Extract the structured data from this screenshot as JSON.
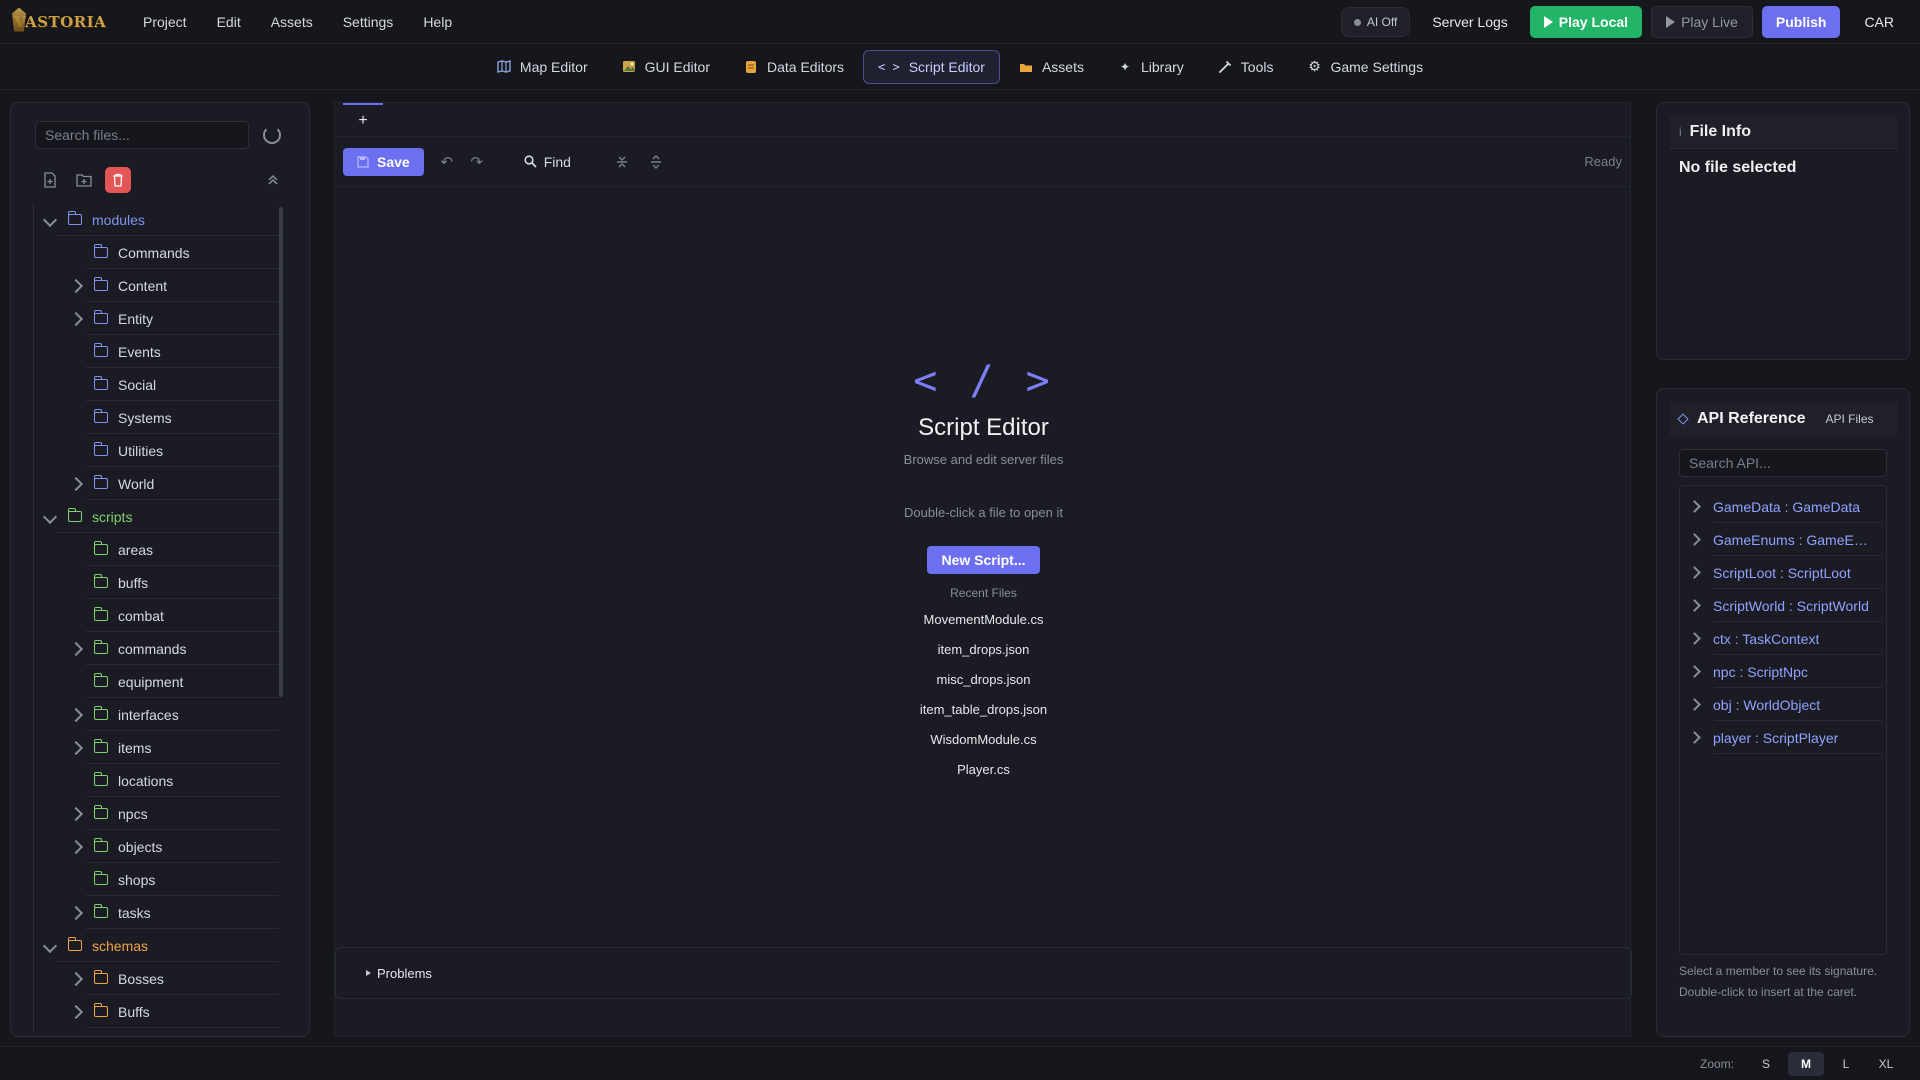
{
  "app": {
    "logo_text": "VASTORIA",
    "menu": [
      "Project",
      "Edit",
      "Assets",
      "Settings",
      "Help"
    ],
    "ai_toggle": "AI Off",
    "server_logs": "Server Logs",
    "play_local": "Play Local",
    "play_live": "Play Live",
    "publish": "Publish",
    "user": "CAR"
  },
  "tabs": [
    {
      "label": "Map Editor",
      "icon": "map-icon",
      "active": false
    },
    {
      "label": "GUI Editor",
      "icon": "image-icon",
      "active": false
    },
    {
      "label": "Data Editors",
      "icon": "database-icon",
      "active": false
    },
    {
      "label": "Script Editor",
      "icon": "code-icon",
      "active": true
    },
    {
      "label": "Assets",
      "icon": "folder-icon",
      "active": false
    },
    {
      "label": "Library",
      "icon": "sparkle-icon",
      "active": false
    },
    {
      "label": "Tools",
      "icon": "wrench-icon",
      "active": false
    },
    {
      "label": "Game Settings",
      "icon": "gear-icon",
      "active": false
    }
  ],
  "files": {
    "search_placeholder": "Search files...",
    "tree": [
      {
        "label": "modules",
        "level": 0,
        "expanded": true,
        "color": "blue"
      },
      {
        "label": "Commands",
        "level": 1,
        "expandable": false,
        "color": "blue"
      },
      {
        "label": "Content",
        "level": 1,
        "expandable": true,
        "color": "blue"
      },
      {
        "label": "Entity",
        "level": 1,
        "expandable": true,
        "color": "blue"
      },
      {
        "label": "Events",
        "level": 1,
        "expandable": false,
        "color": "blue"
      },
      {
        "label": "Social",
        "level": 1,
        "expandable": false,
        "color": "blue"
      },
      {
        "label": "Systems",
        "level": 1,
        "expandable": false,
        "color": "blue"
      },
      {
        "label": "Utilities",
        "level": 1,
        "expandable": false,
        "color": "blue"
      },
      {
        "label": "World",
        "level": 1,
        "expandable": true,
        "color": "blue"
      },
      {
        "label": "scripts",
        "level": 0,
        "expanded": true,
        "color": "green"
      },
      {
        "label": "areas",
        "level": 1,
        "expandable": false,
        "color": "green"
      },
      {
        "label": "buffs",
        "level": 1,
        "expandable": false,
        "color": "green"
      },
      {
        "label": "combat",
        "level": 1,
        "expandable": false,
        "color": "green"
      },
      {
        "label": "commands",
        "level": 1,
        "expandable": true,
        "color": "green"
      },
      {
        "label": "equipment",
        "level": 1,
        "expandable": false,
        "color": "green"
      },
      {
        "label": "interfaces",
        "level": 1,
        "expandable": true,
        "color": "green"
      },
      {
        "label": "items",
        "level": 1,
        "expandable": true,
        "color": "green"
      },
      {
        "label": "locations",
        "level": 1,
        "expandable": false,
        "color": "green"
      },
      {
        "label": "npcs",
        "level": 1,
        "expandable": true,
        "color": "green"
      },
      {
        "label": "objects",
        "level": 1,
        "expandable": true,
        "color": "green"
      },
      {
        "label": "shops",
        "level": 1,
        "expandable": false,
        "color": "green"
      },
      {
        "label": "tasks",
        "level": 1,
        "expandable": true,
        "color": "green"
      },
      {
        "label": "schemas",
        "level": 0,
        "expanded": true,
        "color": "orange"
      },
      {
        "label": "Bosses",
        "level": 1,
        "expandable": true,
        "color": "orange"
      },
      {
        "label": "Buffs",
        "level": 1,
        "expandable": true,
        "color": "orange"
      }
    ]
  },
  "editor": {
    "add_tab": "+",
    "save": "Save",
    "find": "Find",
    "status": "Ready",
    "welcome_icon": "< / >",
    "welcome_title": "Script Editor",
    "welcome_sub": "Browse and edit server files",
    "hint": "Double-click a file to open it",
    "new_script": "New Script...",
    "recent_title": "Recent Files",
    "recent_files": [
      "MovementModule.cs",
      "item_drops.json",
      "misc_drops.json",
      "item_table_drops.json",
      "WisdomModule.cs",
      "Player.cs"
    ],
    "problems": "Problems"
  },
  "file_info": {
    "title": "File Info",
    "info_glyph": "i",
    "empty": "No file selected"
  },
  "api": {
    "title": "API Reference",
    "files_tab": "API Files",
    "search_placeholder": "Search API...",
    "items": [
      "GameData : GameData",
      "GameEnums : GameEnums",
      "ScriptLoot : ScriptLoot",
      "ScriptWorld : ScriptWorld",
      "ctx : TaskContext",
      "npc : ScriptNpc",
      "obj : WorldObject",
      "player : ScriptPlayer"
    ],
    "footer": "Select a member to see its signature. Double-click to insert at the caret."
  },
  "statusbar": {
    "zoom_label": "Zoom:",
    "zoom_options": [
      "S",
      "M",
      "L",
      "XL"
    ],
    "zoom_active": "M"
  },
  "colors": {
    "accent": "#6c6ff0",
    "play_green": "#22b567",
    "danger": "#e35656",
    "folder_blue": "#7f94f0",
    "folder_green": "#7fd16e",
    "folder_orange": "#f1a34b"
  }
}
